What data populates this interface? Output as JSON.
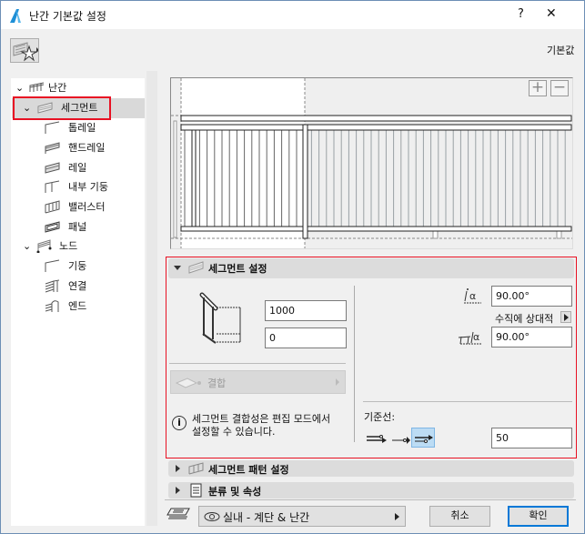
{
  "window": {
    "title": "난간 기본값 설정",
    "help": "?",
    "close": "✕"
  },
  "toolbar": {
    "defaults_label": "기본값"
  },
  "tree": {
    "root": "난간",
    "segment": "세그먼트",
    "segment_children": [
      "톱레일",
      "핸드레일",
      "레일",
      "내부 기둥",
      "밸러스터",
      "패널"
    ],
    "node": "노드",
    "node_children": [
      "기둥",
      "연결",
      "엔드"
    ]
  },
  "segment_settings": {
    "title": "세그먼트 설정",
    "height_value": "1000",
    "offset_value": "0",
    "join_label": "결합",
    "info_text_1": "세그먼트 결합성은 편집 모드에서",
    "info_text_2": "설정할 수 있습니다.",
    "angle1_value": "90.00°",
    "relative_label": "수직에 상대적",
    "angle2_value": "90.00°",
    "reference_label": "기준선:",
    "reference_offset": "50"
  },
  "sections": {
    "pattern": "세그먼트 패턴 설정",
    "classification": "분류 및 속성"
  },
  "footer": {
    "layer": "실내 - 계단 & 난간",
    "cancel": "취소",
    "ok": "확인"
  },
  "colors": {
    "highlight": "#e81123",
    "ok_border": "#0078d7",
    "selected_ref": "#bcdcf4"
  }
}
